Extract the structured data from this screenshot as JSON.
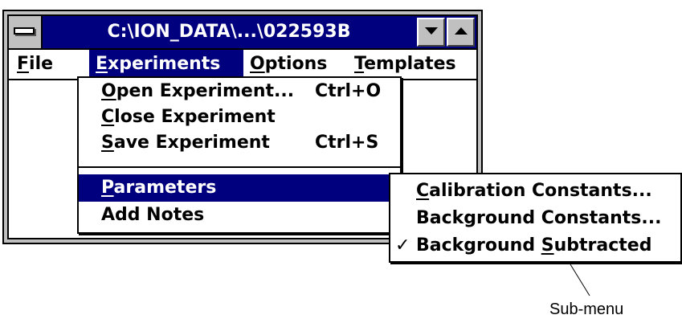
{
  "window": {
    "title": "C:\\ION_DATA\\...\\022593B"
  },
  "menubar": {
    "file": {
      "pre": "",
      "mnemonic": "F",
      "post": "ile"
    },
    "experiments": {
      "pre": "",
      "mnemonic": "E",
      "post": "xperiments"
    },
    "options": {
      "pre": "",
      "mnemonic": "O",
      "post": "ptions"
    },
    "templates": {
      "pre": "",
      "mnemonic": "T",
      "post": "emplates"
    }
  },
  "experiments_menu": {
    "open": {
      "mnemonic": "O",
      "post": "pen Experiment...",
      "shortcut": "Ctrl+O"
    },
    "close": {
      "mnemonic": "C",
      "post": "lose Experiment",
      "shortcut": ""
    },
    "save": {
      "mnemonic": "S",
      "post": "ave Experiment",
      "shortcut": "Ctrl+S"
    },
    "parameters": {
      "mnemonic": "P",
      "post": "arameters"
    },
    "add_notes": {
      "label": "Add Notes"
    }
  },
  "parameters_submenu": {
    "calibration": {
      "pre": "",
      "mnemonic": "C",
      "post": "alibration Constants..."
    },
    "background": {
      "label": "Background Constants..."
    },
    "subtracted": {
      "check": "✓",
      "pre": "Background ",
      "mnemonic": "S",
      "post": "ubtracted"
    }
  },
  "callout": {
    "label": "Sub-menu"
  },
  "colors": {
    "highlight": "#00007f",
    "menu_bg": "#ffffff",
    "frame": "#c0c0c0"
  },
  "icons": {
    "system_menu": "system-menu-icon",
    "minimize": "minimize-arrow-icon",
    "maximize": "maximize-arrow-icon",
    "submenu": "submenu-arrow-icon",
    "check": "checkmark-icon"
  }
}
